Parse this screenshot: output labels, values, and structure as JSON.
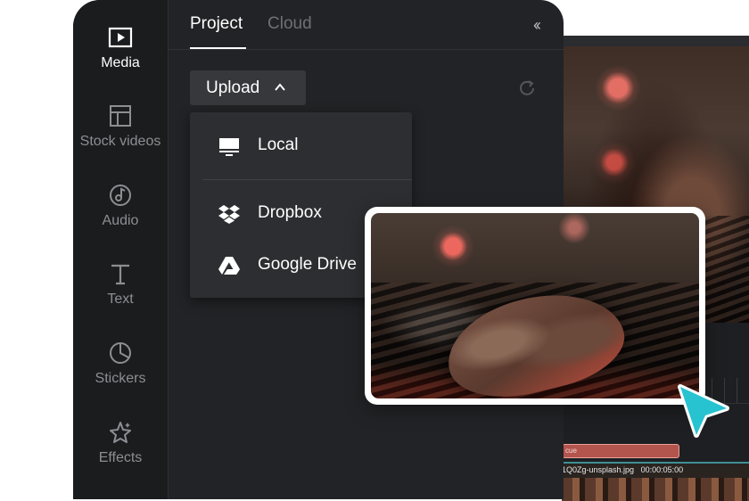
{
  "sidebar": {
    "items": [
      {
        "label": "Media",
        "icon": "media-icon",
        "active": true
      },
      {
        "label": "Stock videos",
        "icon": "stock-videos-icon",
        "active": false
      },
      {
        "label": "Audio",
        "icon": "audio-icon",
        "active": false
      },
      {
        "label": "Text",
        "icon": "text-icon",
        "active": false
      },
      {
        "label": "Stickers",
        "icon": "stickers-icon",
        "active": false
      },
      {
        "label": "Effects",
        "icon": "effects-icon",
        "active": false
      }
    ]
  },
  "tabs": {
    "project": "Project",
    "cloud": "Cloud",
    "active": "Project"
  },
  "upload": {
    "label": "Upload",
    "menu": [
      {
        "label": "Local",
        "icon": "monitor-icon"
      },
      {
        "label": "Dropbox",
        "icon": "dropbox-icon"
      },
      {
        "label": "Google Drive",
        "icon": "google-drive-icon"
      }
    ]
  },
  "timeline": {
    "clip_red_label": "cue",
    "clip_main_name": "1Q0Zg-unsplash.jpg",
    "clip_main_duration": "00:00:05:00"
  },
  "colors": {
    "panel_bg": "#222326",
    "sidebar_bg": "#1b1c1e",
    "accent_cursor": "#27c3d1",
    "dropdown_bg": "#2d2e31"
  }
}
